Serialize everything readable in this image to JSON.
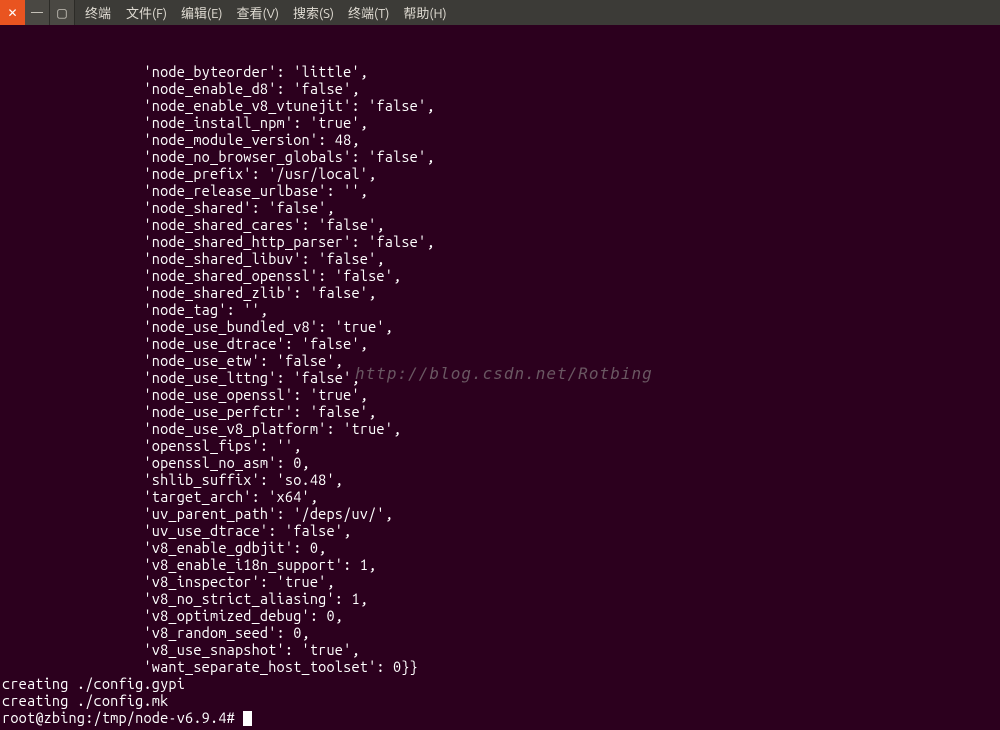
{
  "window": {
    "app_title": "终端",
    "close_symbol": "✕",
    "min_symbol": "—",
    "max_symbol": "▢"
  },
  "menu": {
    "file": "文件(F)",
    "edit": "编辑(E)",
    "view": "查看(V)",
    "search": "搜索(S)",
    "terminal": "终端(T)",
    "help": "帮助(H)"
  },
  "terminal": {
    "indent": "                 ",
    "config_lines": [
      "'node_byteorder': 'little',",
      "'node_enable_d8': 'false',",
      "'node_enable_v8_vtunejit': 'false',",
      "'node_install_npm': 'true',",
      "'node_module_version': 48,",
      "'node_no_browser_globals': 'false',",
      "'node_prefix': '/usr/local',",
      "'node_release_urlbase': '',",
      "'node_shared': 'false',",
      "'node_shared_cares': 'false',",
      "'node_shared_http_parser': 'false',",
      "'node_shared_libuv': 'false',",
      "'node_shared_openssl': 'false',",
      "'node_shared_zlib': 'false',",
      "'node_tag': '',",
      "'node_use_bundled_v8': 'true',",
      "'node_use_dtrace': 'false',",
      "'node_use_etw': 'false',",
      "'node_use_lttng': 'false',",
      "'node_use_openssl': 'true',",
      "'node_use_perfctr': 'false',",
      "'node_use_v8_platform': 'true',",
      "'openssl_fips': '',",
      "'openssl_no_asm': 0,",
      "'shlib_suffix': 'so.48',",
      "'target_arch': 'x64',",
      "'uv_parent_path': '/deps/uv/',",
      "'uv_use_dtrace': 'false',",
      "'v8_enable_gdbjit': 0,",
      "'v8_enable_i18n_support': 1,",
      "'v8_inspector': 'true',",
      "'v8_no_strict_aliasing': 1,",
      "'v8_optimized_debug': 0,",
      "'v8_random_seed': 0,",
      "'v8_use_snapshot': 'true',",
      "'want_separate_host_toolset': 0}}"
    ],
    "creating_gypi": "creating ./config.gypi",
    "creating_mk": "creating ./config.mk",
    "prompt": "root@zbing:/tmp/node-v6.9.4# "
  },
  "watermark": "http://blog.csdn.net/Rotbing"
}
